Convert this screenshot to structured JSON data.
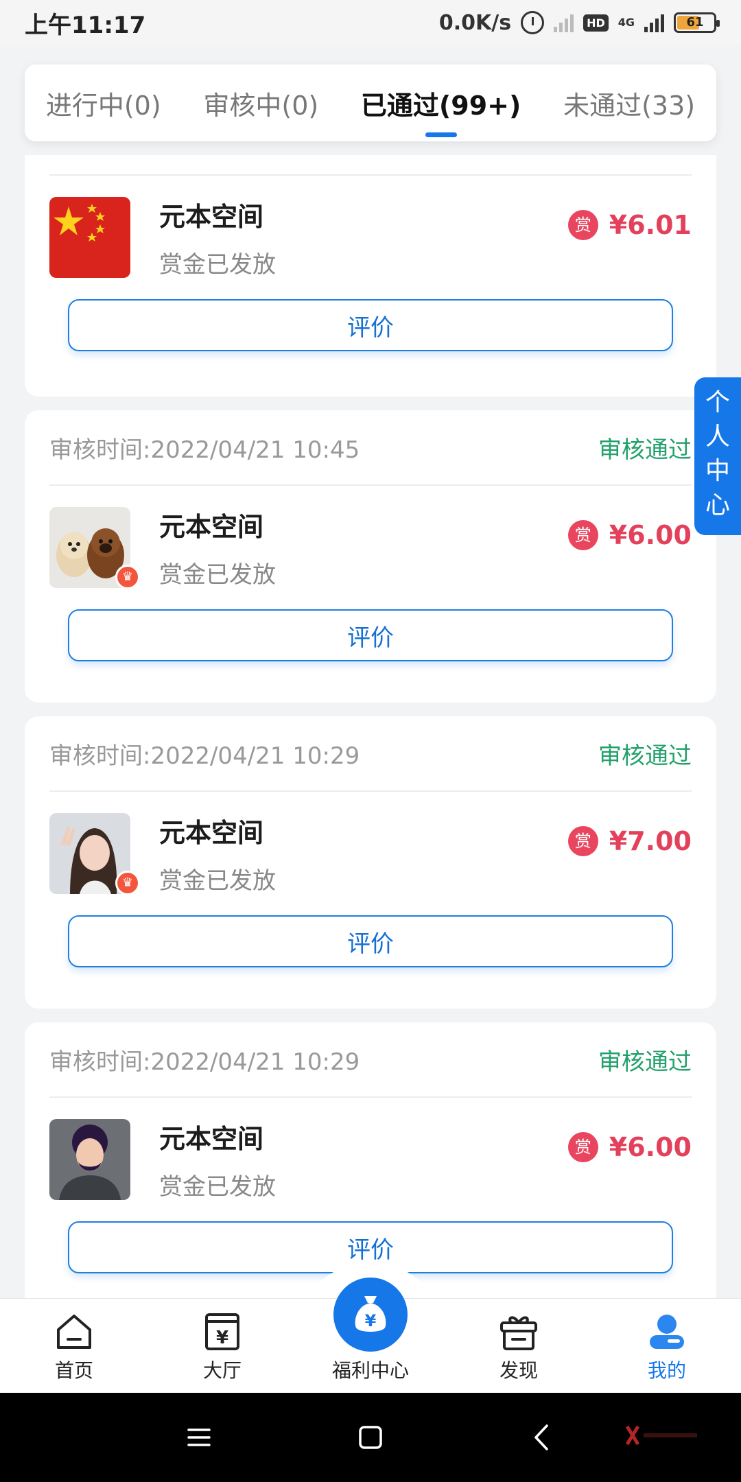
{
  "status_bar": {
    "time": "上午11:17",
    "net_speed": "0.0K/s",
    "hd": "HD",
    "net_type": "4G",
    "battery": "61",
    "battery_level": 0.61
  },
  "tabs": [
    {
      "label": "进行中(0)",
      "active": false
    },
    {
      "label": "审核中(0)",
      "active": false
    },
    {
      "label": "已通过(99+)",
      "active": true
    },
    {
      "label": "未通过(33)",
      "active": false
    }
  ],
  "cards": [
    {
      "title": "元本空间",
      "status_sub": "赏金已发放",
      "reward_badge": "赏",
      "amount": "¥6.01",
      "rate_label": "评价",
      "avatar": "china-flag-avatar"
    },
    {
      "review_time": "审核时间:2022/04/21 10:45",
      "review_status": "审核通过",
      "title": "元本空间",
      "status_sub": "赏金已发放",
      "reward_badge": "赏",
      "amount": "¥6.00",
      "rate_label": "评价",
      "avatar": "puppies-avatar"
    },
    {
      "review_time": "审核时间:2022/04/21 10:29",
      "review_status": "审核通过",
      "title": "元本空间",
      "status_sub": "赏金已发放",
      "reward_badge": "赏",
      "amount": "¥7.00",
      "rate_label": "评价",
      "avatar": "woman-avatar"
    },
    {
      "review_time": "审核时间:2022/04/21 10:29",
      "review_status": "审核通过",
      "title": "元本空间",
      "status_sub": "赏金已发放",
      "reward_badge": "赏",
      "amount": "¥6.00",
      "rate_label": "评价",
      "avatar": "man-avatar"
    }
  ],
  "side_button": {
    "chars": [
      "个",
      "人",
      "中",
      "心"
    ]
  },
  "bottom_nav": [
    {
      "label": "首页",
      "icon": "home-icon"
    },
    {
      "label": "大厅",
      "icon": "hall-icon"
    },
    {
      "label": "福利中心",
      "icon": "money-bag-icon"
    },
    {
      "label": "发现",
      "icon": "gift-icon"
    },
    {
      "label": "我的",
      "icon": "profile-icon",
      "active": true
    }
  ],
  "colors": {
    "accent": "#1677e8",
    "reward": "#e3415b",
    "approved": "#22a06b"
  }
}
